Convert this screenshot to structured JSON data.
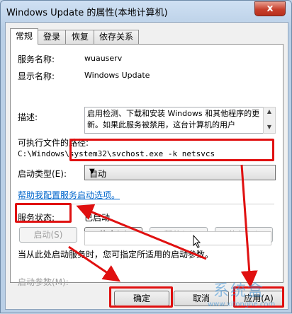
{
  "window": {
    "title": "Windows Update 的属性(本地计算机)",
    "close": "x"
  },
  "tabs": [
    {
      "label": "常规",
      "active": true
    },
    {
      "label": "登录",
      "active": false
    },
    {
      "label": "恢复",
      "active": false
    },
    {
      "label": "依存关系",
      "active": false
    }
  ],
  "general": {
    "service_name_label": "服务名称:",
    "service_name": "wuauserv",
    "display_name_label": "显示名称:",
    "display_name": "Windows Update",
    "description_label": "描述:",
    "description": "启用检测、下载和安装 Windows 和其他程序的更新。如果此服务被禁用，这台计算机的用户",
    "path_label": "可执行文件的路径:",
    "path": "C:\\Windows\\system32\\svchost.exe -k netsvcs",
    "startup_type_label": "启动类型(E):",
    "startup_type": "自动",
    "help_link": "帮助我配置服务启动选项。",
    "status_label": "服务状态:",
    "status": "已启动",
    "start_btn": "启动(S)",
    "stop_btn": "停止(T)",
    "pause_btn": "暂停(P)",
    "resume_btn": "恢复(R)",
    "hint": "当从此处启动服务时，您可指定所适用的启动参数。",
    "params_label": "启动参数(M):"
  },
  "footer": {
    "ok": "确定",
    "cancel": "取消",
    "apply": "应用(A)"
  },
  "watermark": {
    "text": "系统盒",
    "url": "www.xitonghe.com"
  },
  "colors": {
    "annotation_red": "#e01010",
    "link": "#0066cc"
  }
}
